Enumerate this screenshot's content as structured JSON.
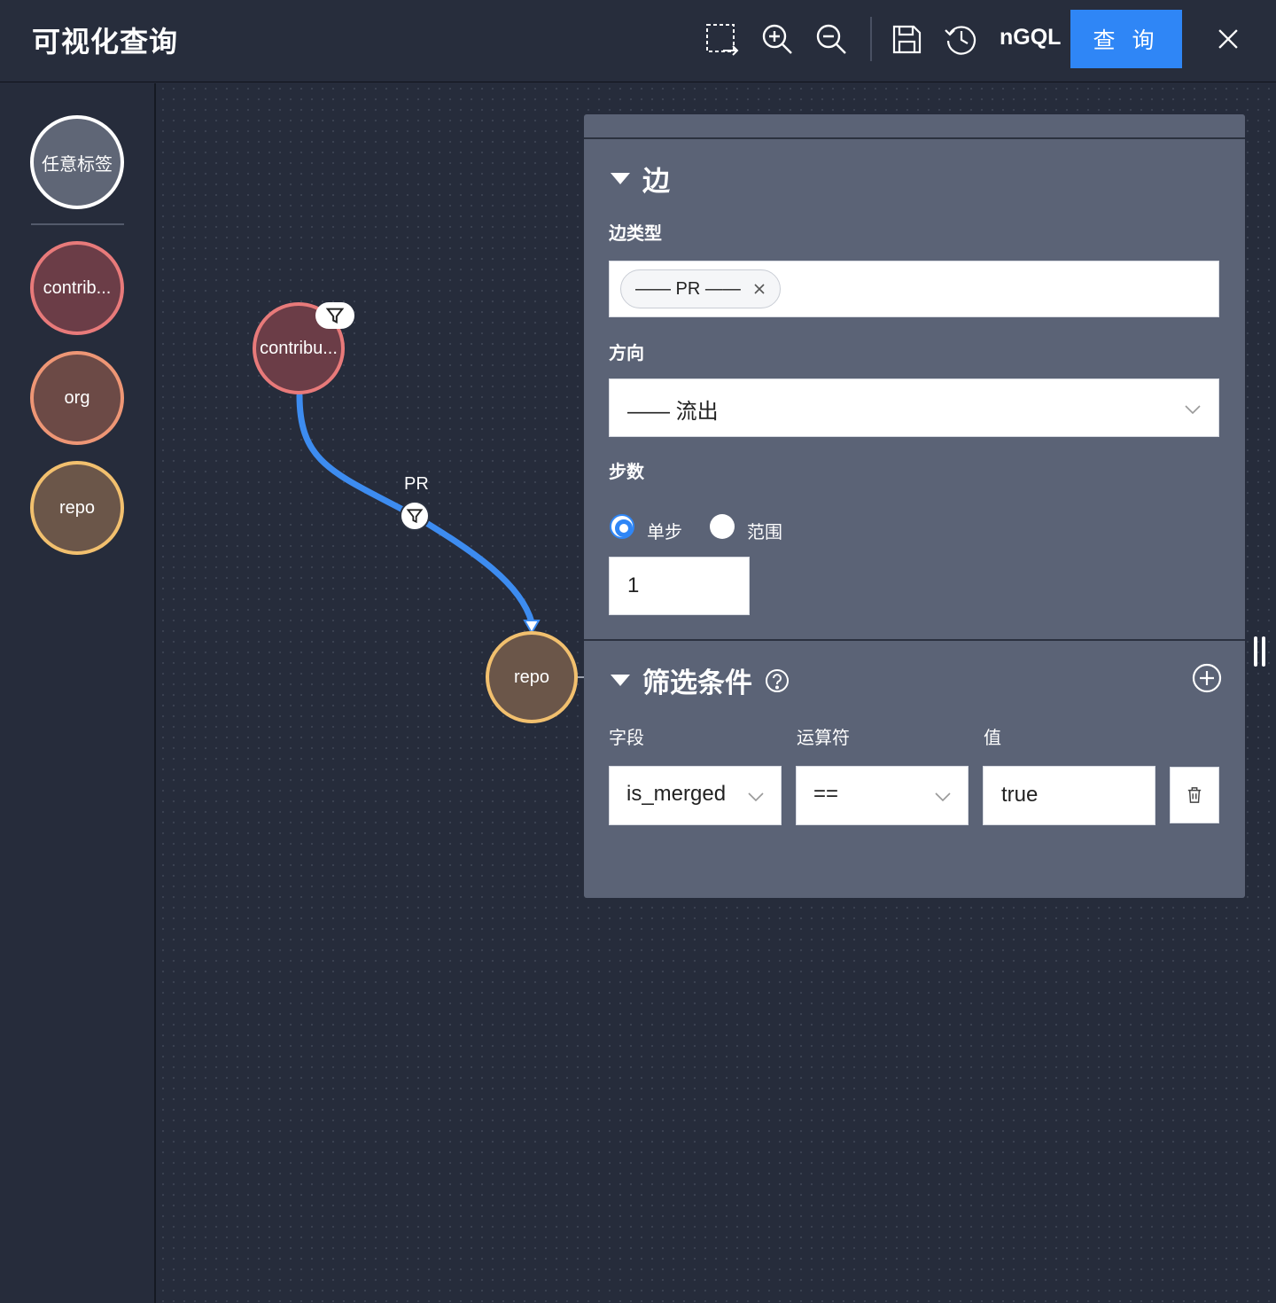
{
  "header": {
    "title": "可视化查询",
    "ngql_label": "nGQL",
    "query_label": "查 询"
  },
  "sidebar": {
    "any_tag_label": "任意标签",
    "nodes": [
      {
        "label": "contrib...",
        "fill": "#6b3d47",
        "stroke": "#e87a7a"
      },
      {
        "label": "org",
        "fill": "#6c4a46",
        "stroke": "#ee9675"
      },
      {
        "label": "repo",
        "fill": "#6b5649",
        "stroke": "#f2c06e"
      }
    ]
  },
  "graph": {
    "source_label": "contribu...",
    "target_label": "repo",
    "edge_label": "PR",
    "edge_color": "#3d8cf0"
  },
  "panel": {
    "edge_section_title": "边",
    "edge_type_label": "边类型",
    "edge_type_tag": "—— PR ——",
    "direction_label": "方向",
    "direction_value": "—— 流出",
    "steps_label": "步数",
    "radio_single": "单步",
    "radio_range": "范围",
    "steps_value": "1",
    "filter_section_title": "筛选条件",
    "col_field": "字段",
    "col_operator": "运算符",
    "col_value": "值",
    "field_value": "is_merged",
    "operator_value": "==",
    "value_value": "true"
  },
  "colors": {
    "accent": "#2f86f6",
    "panel_bg": "#5b6376",
    "canvas_bg": "#262c3b"
  }
}
